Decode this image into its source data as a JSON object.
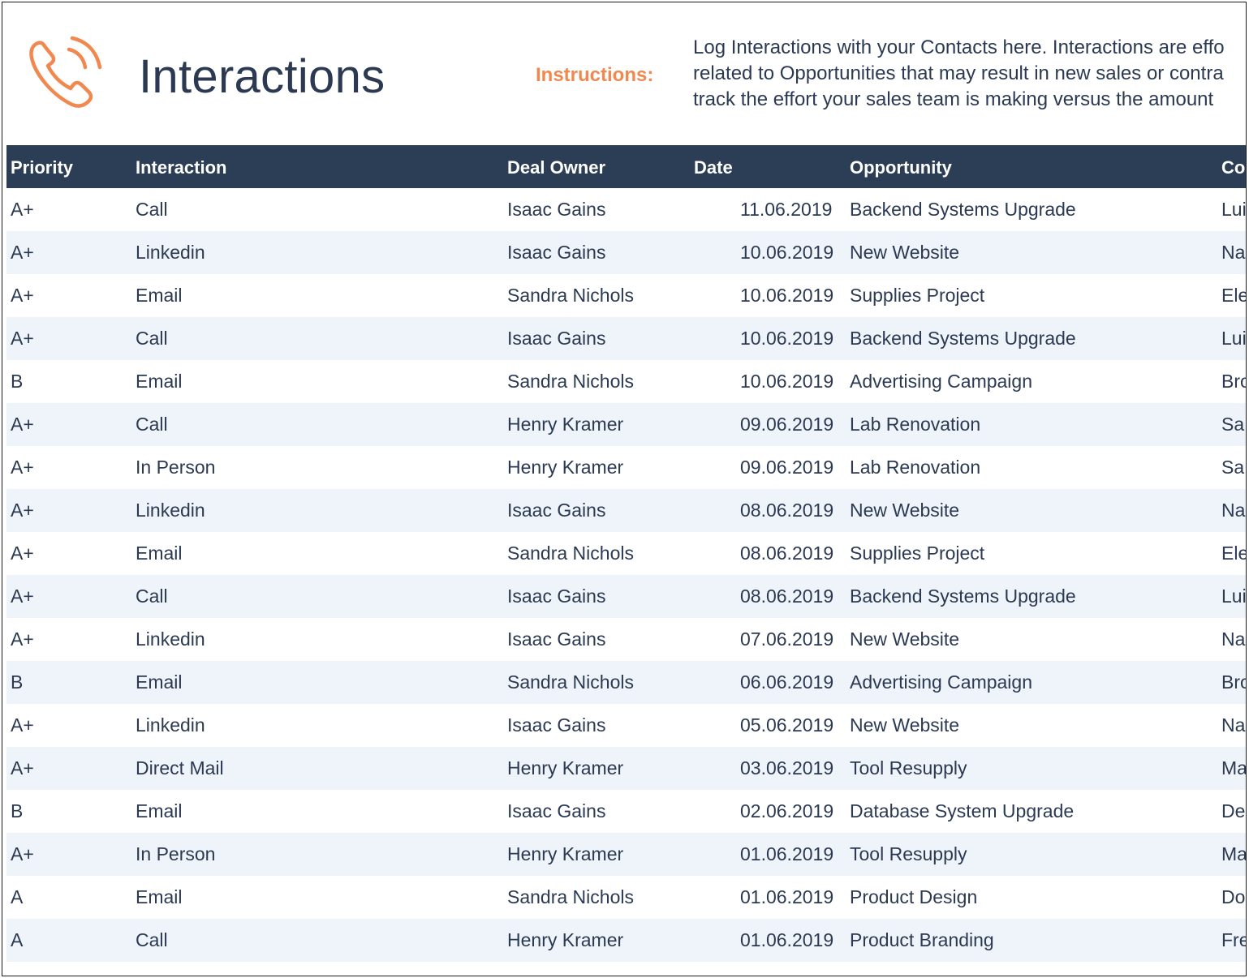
{
  "header": {
    "icon": "phone-ringing-icon",
    "title": "Interactions",
    "instructions_label": "Instructions:",
    "instructions_lines": [
      "Log Interactions with your Contacts here. Interactions are effo",
      "related to Opportunities that may result in new sales or contra",
      "track the effort your sales team is making versus the amount"
    ]
  },
  "colors": {
    "accent": "#f08850",
    "header_bg": "#2c3e55",
    "text": "#2b3a52",
    "row_alt": "#eef4f9"
  },
  "table": {
    "columns": [
      "Priority",
      "Interaction",
      "Deal Owner",
      "Date",
      "Opportunity",
      "Co"
    ],
    "rows": [
      {
        "priority": "A+",
        "interaction": "Call",
        "owner": "Isaac Gains",
        "date": "11.06.2019",
        "opportunity": "Backend Systems Upgrade",
        "contact": "Lui"
      },
      {
        "priority": "A+",
        "interaction": "Linkedin",
        "owner": "Isaac Gains",
        "date": "10.06.2019",
        "opportunity": "New Website",
        "contact": "Na"
      },
      {
        "priority": "A+",
        "interaction": "Email",
        "owner": "Sandra Nichols",
        "date": "10.06.2019",
        "opportunity": "Supplies Project",
        "contact": "Ele"
      },
      {
        "priority": "A+",
        "interaction": "Call",
        "owner": "Isaac Gains",
        "date": "10.06.2019",
        "opportunity": "Backend Systems Upgrade",
        "contact": "Lui"
      },
      {
        "priority": "B",
        "interaction": "Email",
        "owner": "Sandra Nichols",
        "date": "10.06.2019",
        "opportunity": "Advertising Campaign",
        "contact": "Bro"
      },
      {
        "priority": "A+",
        "interaction": "Call",
        "owner": "Henry Kramer",
        "date": "09.06.2019",
        "opportunity": "Lab Renovation",
        "contact": "Sa"
      },
      {
        "priority": "A+",
        "interaction": "In Person",
        "owner": "Henry Kramer",
        "date": "09.06.2019",
        "opportunity": "Lab Renovation",
        "contact": "Sa"
      },
      {
        "priority": "A+",
        "interaction": "Linkedin",
        "owner": "Isaac Gains",
        "date": "08.06.2019",
        "opportunity": "New Website",
        "contact": "Na"
      },
      {
        "priority": "A+",
        "interaction": "Email",
        "owner": "Sandra Nichols",
        "date": "08.06.2019",
        "opportunity": "Supplies Project",
        "contact": "Ele"
      },
      {
        "priority": "A+",
        "interaction": "Call",
        "owner": "Isaac Gains",
        "date": "08.06.2019",
        "opportunity": "Backend Systems Upgrade",
        "contact": "Lui"
      },
      {
        "priority": "A+",
        "interaction": "Linkedin",
        "owner": "Isaac Gains",
        "date": "07.06.2019",
        "opportunity": "New Website",
        "contact": "Na"
      },
      {
        "priority": "B",
        "interaction": "Email",
        "owner": "Sandra Nichols",
        "date": "06.06.2019",
        "opportunity": "Advertising Campaign",
        "contact": "Bro"
      },
      {
        "priority": "A+",
        "interaction": "Linkedin",
        "owner": "Isaac Gains",
        "date": "05.06.2019",
        "opportunity": "New Website",
        "contact": "Na"
      },
      {
        "priority": "A+",
        "interaction": "Direct Mail",
        "owner": "Henry Kramer",
        "date": "03.06.2019",
        "opportunity": "Tool Resupply",
        "contact": "Ma"
      },
      {
        "priority": "B",
        "interaction": "Email",
        "owner": "Isaac Gains",
        "date": "02.06.2019",
        "opportunity": "Database System Upgrade",
        "contact": "De"
      },
      {
        "priority": "A+",
        "interaction": "In Person",
        "owner": "Henry Kramer",
        "date": "01.06.2019",
        "opportunity": "Tool Resupply",
        "contact": "Ma"
      },
      {
        "priority": "A",
        "interaction": "Email",
        "owner": "Sandra Nichols",
        "date": "01.06.2019",
        "opportunity": "Product Design",
        "contact": "Do"
      },
      {
        "priority": "A",
        "interaction": "Call",
        "owner": "Henry Kramer",
        "date": "01.06.2019",
        "opportunity": "Product Branding",
        "contact": "Fre"
      }
    ]
  }
}
